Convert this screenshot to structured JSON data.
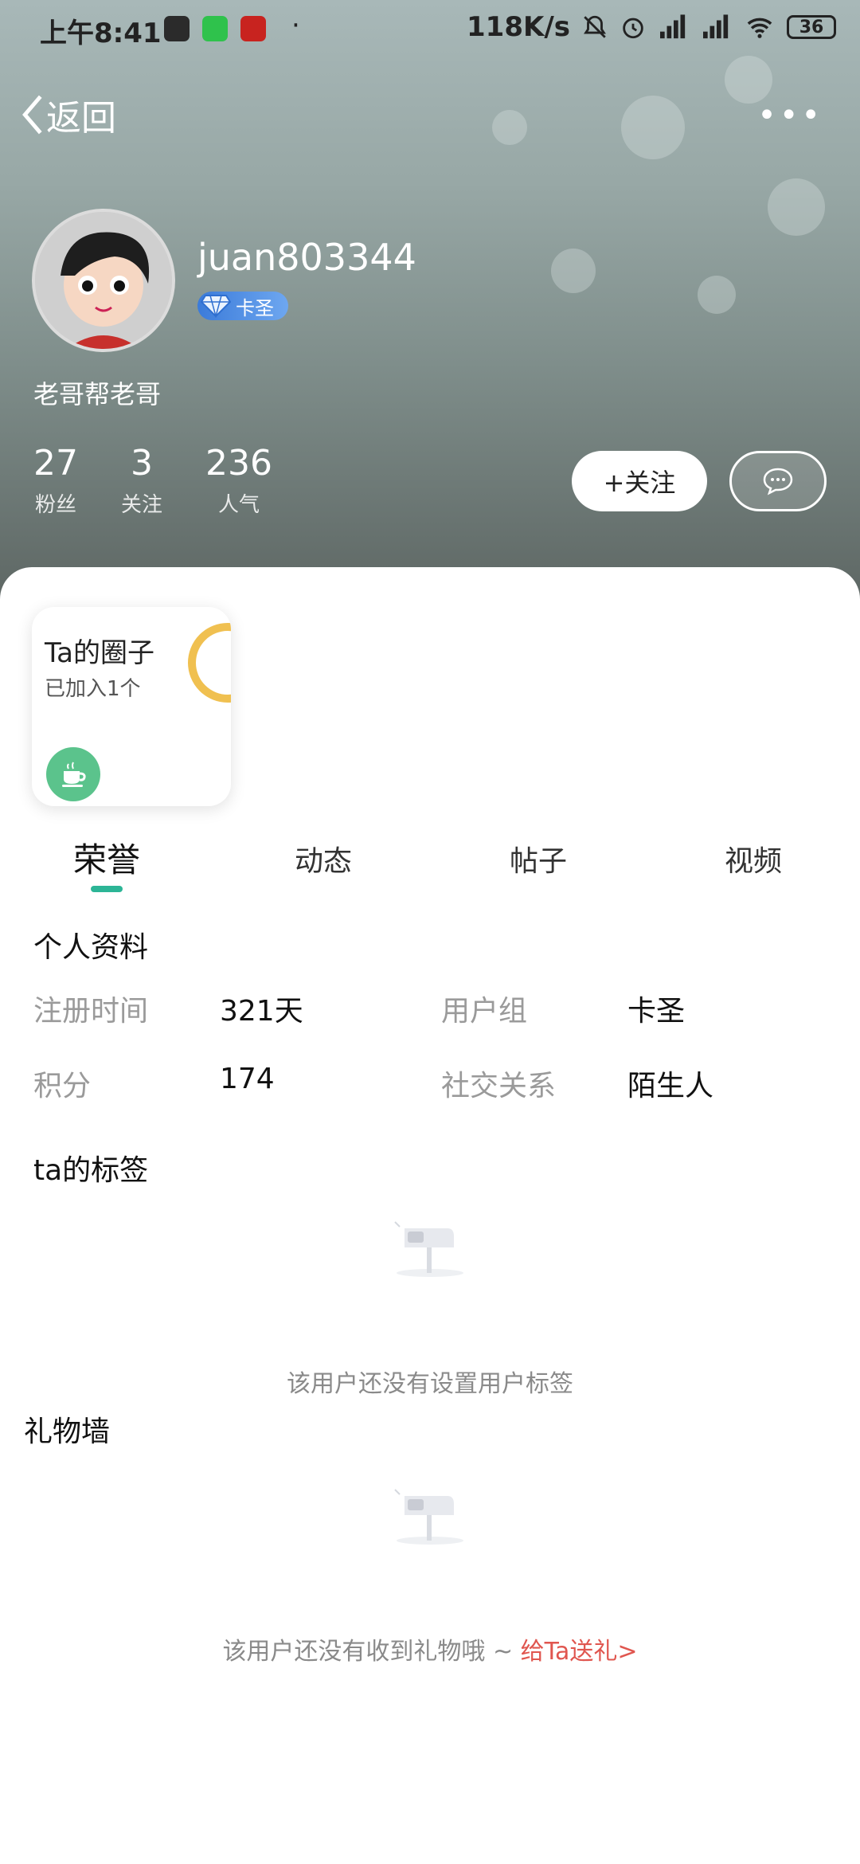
{
  "status_bar": {
    "time": "上午8:41",
    "net_speed": "118K/s",
    "battery": "36"
  },
  "nav": {
    "back_label": "返回",
    "more_label": "•••"
  },
  "profile": {
    "username": "juan803344",
    "badge_label": "卡圣",
    "bio": "老哥帮老哥",
    "stats": [
      {
        "num": "27",
        "label": "粉丝"
      },
      {
        "num": "3",
        "label": "关注"
      },
      {
        "num": "236",
        "label": "人气"
      }
    ],
    "follow_label": "+关注"
  },
  "circle_card": {
    "title": "Ta的圈子",
    "subtitle": "已加入1个"
  },
  "tabs": [
    {
      "label": "荣誉",
      "active": true
    },
    {
      "label": "动态",
      "active": false
    },
    {
      "label": "帖子",
      "active": false
    },
    {
      "label": "视频",
      "active": false
    }
  ],
  "personal_info": {
    "title": "个人资料",
    "rows": [
      {
        "k1": "注册时间",
        "v1": "321天",
        "k2": "用户组",
        "v2": "卡圣"
      },
      {
        "k1": "积分",
        "v1": "174",
        "k2": "社交关系",
        "v2": "陌生人"
      }
    ]
  },
  "tags": {
    "title": "ta的标签",
    "empty_text": "该用户还没有设置用户标签"
  },
  "gifts": {
    "title": "礼物墙",
    "empty_text": "该用户还没有收到礼物哦 ~ ",
    "gift_link": "给Ta送礼>"
  },
  "colors": {
    "accent": "#2cb596",
    "link": "#e0564f",
    "badge": "#3b7bd9"
  }
}
